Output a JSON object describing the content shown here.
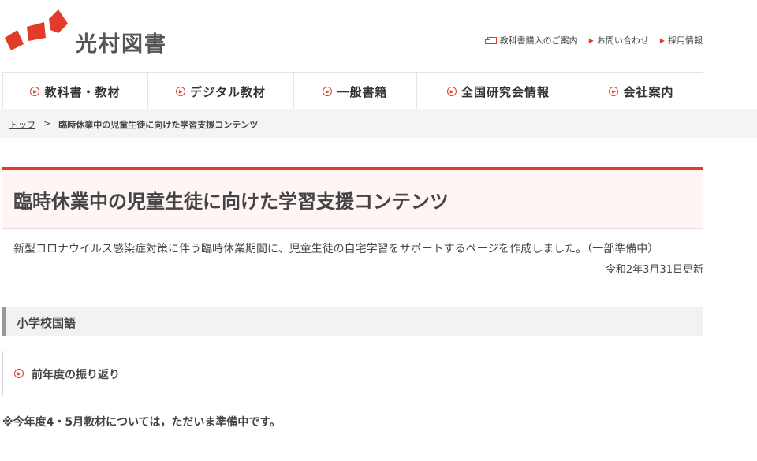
{
  "header": {
    "site_name": "光村図書",
    "links": [
      {
        "label": "教科書購入のご案内",
        "icon": "window-icon"
      },
      {
        "label": "お問い合わせ",
        "icon": "arrow-icon"
      },
      {
        "label": "採用情報",
        "icon": "arrow-icon"
      }
    ]
  },
  "nav": {
    "items": [
      "教科書・教材",
      "デジタル教材",
      "一般書籍",
      "全国研究会情報",
      "会社案内"
    ]
  },
  "breadcrumb": {
    "home": "トップ",
    "separator": ">",
    "current": "臨時休業中の児童生徒に向けた学習支援コンテンツ"
  },
  "page": {
    "title": "臨時休業中の児童生徒に向けた学習支援コンテンツ",
    "intro": "新型コロナウイルス感染症対策に伴う臨時休業期間に、児童生徒の自宅学習をサポートするページを作成しました。（一部準備中）",
    "updated": "令和2年3月31日更新",
    "section_title": "小学校国語",
    "link_label": "前年度の振り返り",
    "note": "※今年度4・5月教材については，ただいま準備中です。"
  },
  "colors": {
    "accent": "#e23b2a"
  }
}
